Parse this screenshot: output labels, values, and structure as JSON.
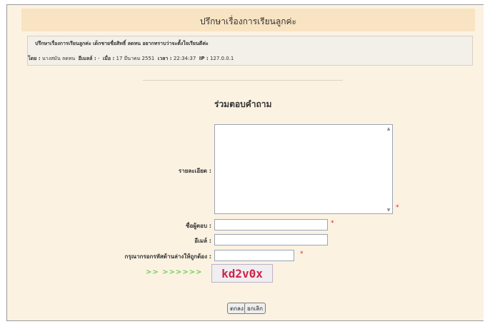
{
  "header": {
    "title": "ปรึกษาเรื่องการเรียนลูกค่ะ"
  },
  "post": {
    "title": "ปรึกษาเรื่องการเรียนลูกค่ะ เด็กชายชื่อสิทธิ์ ลดหน อยากทราบว่าจะตั้งใจเรียนดีค่ะ",
    "by_label": "โดย :",
    "author": "นางสมัน ลดหน",
    "email_label": "อีเมลล์ :",
    "email": "-",
    "date_label": "เมื่อ :",
    "date": "17 มีนาคม 2551",
    "time_label": "เวลา :",
    "time": "22:34:37",
    "ip_label": "IP :",
    "ip": "127.0.0.1"
  },
  "reply_form": {
    "title": "ร่วมตอบคำถาม",
    "detail_label": "รายละเอียด :",
    "name_label": "ชื่อผู้ตอบ :",
    "email_label": "อีเมล์ :",
    "captcha_label": "กรุณากรอกรหัสด้านล่างให้ถูกต้อง :",
    "required_mark": "*",
    "captcha_prefix": ">> >>>>>>",
    "captcha_code": "kd2v0x",
    "submit_label": "ตกลง",
    "cancel_label": "ยกเลิก"
  },
  "colors": {
    "background": "#fbf2e2",
    "header": "#f8e3c2",
    "required": "#e22222",
    "captcha_text": "#d0234a"
  },
  "icons": [
    "scroll-up-icon",
    "scroll-down-icon"
  ]
}
